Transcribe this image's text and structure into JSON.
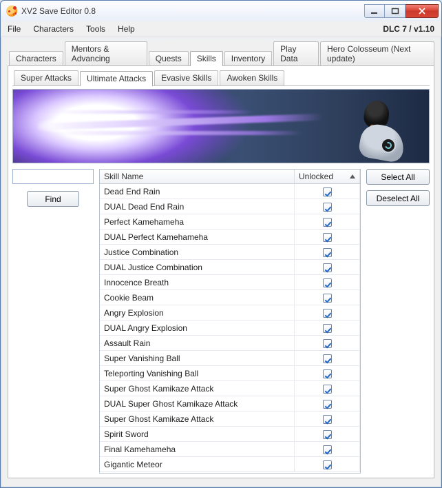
{
  "window": {
    "title": "XV2 Save Editor 0.8"
  },
  "menubar": {
    "file": "File",
    "characters": "Characters",
    "tools": "Tools",
    "help": "Help",
    "version": "DLC 7 / v1.10"
  },
  "main_tabs": {
    "items": [
      {
        "label": "Characters"
      },
      {
        "label": "Mentors & Advancing"
      },
      {
        "label": "Quests"
      },
      {
        "label": "Skills"
      },
      {
        "label": "Inventory"
      },
      {
        "label": "Play Data"
      },
      {
        "label": "Hero Colosseum (Next update)"
      }
    ],
    "selected_index": 3
  },
  "sub_tabs": {
    "items": [
      {
        "label": "Super Attacks"
      },
      {
        "label": "Ultimate Attacks"
      },
      {
        "label": "Evasive Skills"
      },
      {
        "label": "Awoken Skills"
      }
    ],
    "selected_index": 1
  },
  "search": {
    "value": "",
    "find_label": "Find"
  },
  "grid": {
    "columns": {
      "name": "Skill Name",
      "unlocked": "Unlocked"
    },
    "rows": [
      {
        "name": "Dead End Rain",
        "unlocked": true
      },
      {
        "name": "DUAL Dead End Rain",
        "unlocked": true
      },
      {
        "name": "Perfect Kamehameha",
        "unlocked": true
      },
      {
        "name": "DUAL Perfect Kamehameha",
        "unlocked": true
      },
      {
        "name": "Justice Combination",
        "unlocked": true
      },
      {
        "name": "DUAL Justice Combination",
        "unlocked": true
      },
      {
        "name": "Innocence Breath",
        "unlocked": true
      },
      {
        "name": "Cookie Beam",
        "unlocked": true
      },
      {
        "name": "Angry Explosion",
        "unlocked": true
      },
      {
        "name": "DUAL Angry Explosion",
        "unlocked": true
      },
      {
        "name": "Assault Rain",
        "unlocked": true
      },
      {
        "name": "Super Vanishing Ball",
        "unlocked": true
      },
      {
        "name": "Teleporting Vanishing Ball",
        "unlocked": true
      },
      {
        "name": "Super Ghost Kamikaze Attack",
        "unlocked": true
      },
      {
        "name": "DUAL Super Ghost Kamikaze Attack",
        "unlocked": true
      },
      {
        "name": "Super Ghost Kamikaze Attack",
        "unlocked": true
      },
      {
        "name": "Spirit Sword",
        "unlocked": true
      },
      {
        "name": "Final Kamehameha",
        "unlocked": true
      },
      {
        "name": "Gigantic Meteor",
        "unlocked": true
      }
    ]
  },
  "side_buttons": {
    "select_all": "Select All",
    "deselect_all": "Deselect All"
  },
  "status_text": ""
}
